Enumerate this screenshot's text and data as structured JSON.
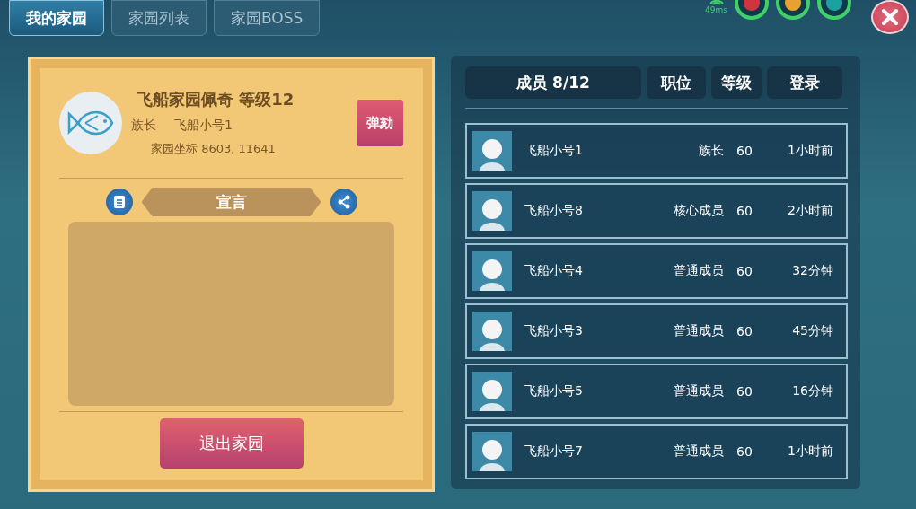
{
  "tabs": [
    {
      "label": "我的家园",
      "selected": true
    },
    {
      "label": "家园列表",
      "selected": false
    },
    {
      "label": "家园BOSS",
      "selected": false
    }
  ],
  "status": {
    "ping": "49ms"
  },
  "home": {
    "title": "飞船家园佩奇 等级12",
    "leader_label": "族长",
    "leader_name": "飞船小号1",
    "coords": "家园坐标 8603, 11641",
    "impeach_button": "弹劾",
    "manifesto_title": "宣言",
    "exit_button": "退出家园"
  },
  "members": {
    "header": {
      "count": "成员 8/12",
      "role": "职位",
      "level": "等级",
      "login": "登录"
    },
    "rows": [
      {
        "name": "飞船小号1",
        "role": "族长",
        "level": "60",
        "login": "1小时前"
      },
      {
        "name": "飞船小号8",
        "role": "核心成员",
        "level": "60",
        "login": "2小时前"
      },
      {
        "name": "飞船小号4",
        "role": "普通成员",
        "level": "60",
        "login": "32分钟"
      },
      {
        "name": "飞船小号3",
        "role": "普通成员",
        "level": "60",
        "login": "45分钟"
      },
      {
        "name": "飞船小号5",
        "role": "普通成员",
        "level": "60",
        "login": "16分钟"
      },
      {
        "name": "飞船小号7",
        "role": "普通成员",
        "level": "60",
        "login": "1小时前"
      }
    ]
  }
}
